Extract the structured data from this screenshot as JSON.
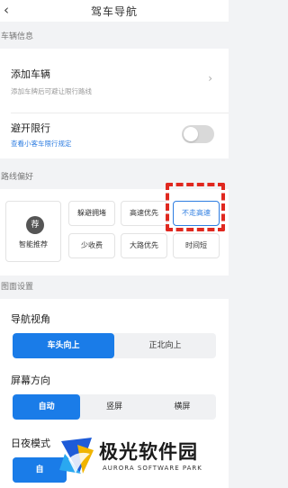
{
  "header": {
    "title": "驾车导航",
    "back_icon": "back-arrow-icon"
  },
  "vehicle_section": {
    "header": "车辆信息",
    "add_vehicle": {
      "title": "添加车辆",
      "subtitle": "添加车牌后可避让限行路线"
    },
    "avoid_restriction": {
      "title": "避开限行",
      "link": "查看小客车限行规定",
      "enabled": false
    }
  },
  "route_section": {
    "header": "路线偏好",
    "smart": {
      "icon_text": "荐",
      "label": "智能推荐"
    },
    "options": [
      {
        "label": "躲避拥堵",
        "selected": false
      },
      {
        "label": "高速优先",
        "selected": false
      },
      {
        "label": "不走高速",
        "selected": true
      },
      {
        "label": "少收费",
        "selected": false
      },
      {
        "label": "大路优先",
        "selected": false
      },
      {
        "label": "时间短",
        "selected": false
      }
    ]
  },
  "display_section": {
    "header": "图面设置",
    "view_angle": {
      "title": "导航视角",
      "options": [
        "车头向上",
        "正北向上"
      ],
      "selected": 0
    },
    "orientation": {
      "title": "屏幕方向",
      "options": [
        "自动",
        "竖屏",
        "横屏"
      ],
      "selected": 0
    },
    "day_night": {
      "title": "日夜模式",
      "selected_label": "自"
    }
  },
  "watermark": {
    "name": "极光软件园",
    "english": "AURORA SOFTWARE PARK"
  },
  "colors": {
    "accent": "#1a7ce8",
    "highlight_frame": "#e0281f"
  }
}
